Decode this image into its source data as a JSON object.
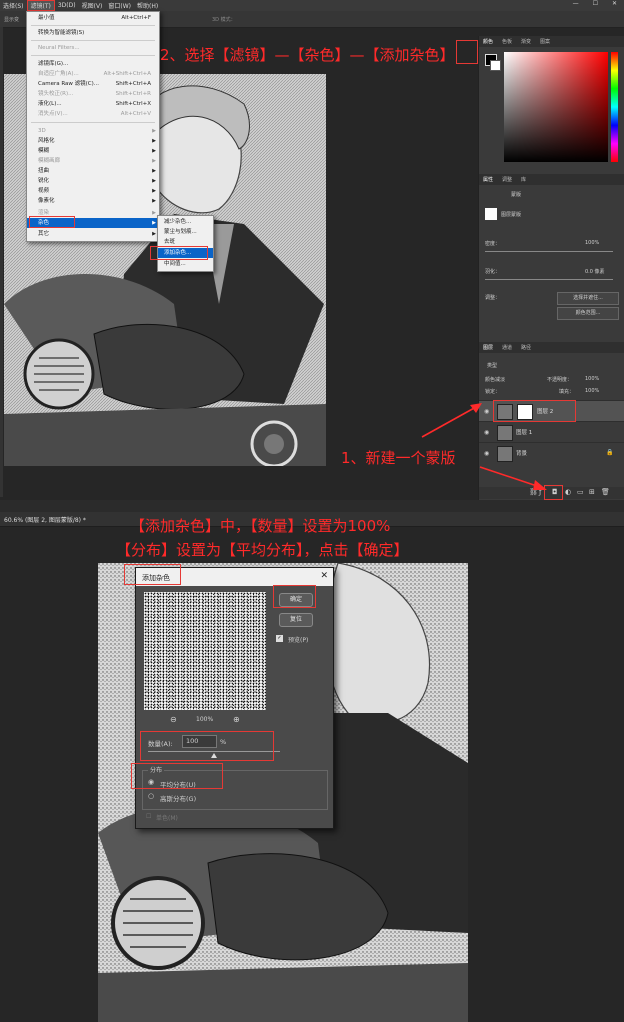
{
  "top_menu": {
    "items": [
      "选择(S)",
      "滤镜(T)",
      "3D(D)",
      "视图(V)",
      "窗口(W)",
      "帮助(H)"
    ],
    "options_left": "显示变",
    "options_3d": "3D 模式："
  },
  "filter_menu": {
    "items": [
      {
        "label": "最小值",
        "shortcut": "Alt+Ctrl+F"
      },
      {
        "label": "转换为智能滤镜(S)",
        "shortcut": ""
      },
      {
        "label": "Neural Filters...",
        "shortcut": ""
      },
      {
        "label": "滤镜库(G)...",
        "shortcut": ""
      },
      {
        "label": "自适应广角(A)...",
        "shortcut": "Alt+Shift+Ctrl+A"
      },
      {
        "label": "Camera Raw 滤镜(C)...",
        "shortcut": "Shift+Ctrl+A"
      },
      {
        "label": "镜头校正(R)...",
        "shortcut": "Shift+Ctrl+R"
      },
      {
        "label": "液化(L)...",
        "shortcut": "Shift+Ctrl+X"
      },
      {
        "label": "消失点(V)...",
        "shortcut": "Alt+Ctrl+V"
      },
      {
        "label": "3D",
        "shortcut": ""
      },
      {
        "label": "风格化",
        "shortcut": ""
      },
      {
        "label": "模糊",
        "shortcut": ""
      },
      {
        "label": "模糊画廊",
        "shortcut": ""
      },
      {
        "label": "扭曲",
        "shortcut": ""
      },
      {
        "label": "锐化",
        "shortcut": ""
      },
      {
        "label": "视频",
        "shortcut": ""
      },
      {
        "label": "像素化",
        "shortcut": ""
      },
      {
        "label": "渲染",
        "shortcut": ""
      },
      {
        "label": "杂色",
        "shortcut": ""
      },
      {
        "label": "其它",
        "shortcut": ""
      }
    ]
  },
  "noise_submenu": {
    "items": [
      "减少杂色...",
      "蒙尘与划痕...",
      "去斑",
      "添加杂色...",
      "中间值..."
    ]
  },
  "right_panel": {
    "color_tabs": [
      "颜色",
      "色板",
      "渐变",
      "图案"
    ],
    "props_tabs": [
      "属性",
      "调整",
      "库"
    ],
    "mask_label": "蒙版",
    "layer_mask_label": "图层蒙版",
    "density_label": "密度：",
    "density_value": "100%",
    "feather_label": "羽化：",
    "feather_value": "0.0 像素",
    "adjust_label": "调整：",
    "select_mask_btn": "选择并遮住...",
    "color_range_btn": "颜色范围...",
    "layers_tabs": [
      "图层",
      "通道",
      "路径"
    ],
    "kind_label": "类型",
    "blend_mode": "颜色减淡",
    "opacity_label": "不透明度：",
    "opacity_value": "100%",
    "lock_label": "锁定：",
    "fill_label": "填充：",
    "fill_value": "100%",
    "layers": [
      "图层 2",
      "图层 1",
      "背景"
    ]
  },
  "doc_tab": {
    "title": "60.6% (图层 2, 图层蒙版/8) *"
  },
  "dialog": {
    "title": "添加杂色",
    "ok": "确定",
    "reset": "复位",
    "preview_label": "预览(P)",
    "zoom": "100%",
    "amount_label": "数量(A):",
    "amount_value": "100",
    "amount_unit": "%",
    "amount_fraction": 0.5,
    "distribution_label": "分布",
    "uniform_label": "平均分布(U)",
    "gaussian_label": "高斯分布(G)",
    "mono_label": "单色(M)"
  },
  "annotations": {
    "step2": "2、选择【滤镜】—【杂色】—【添加杂色】",
    "step1": "1、新建一个蒙版",
    "step3_line1": "【添加杂色】中，【数量】设置为100%",
    "step3_line2": "【分布】设置为【平均分布】，点击【确定】"
  },
  "colors": {
    "annotation": "#ff2a2a",
    "highlight_box": "#e53935",
    "menu_selected": "#0a64c8"
  }
}
